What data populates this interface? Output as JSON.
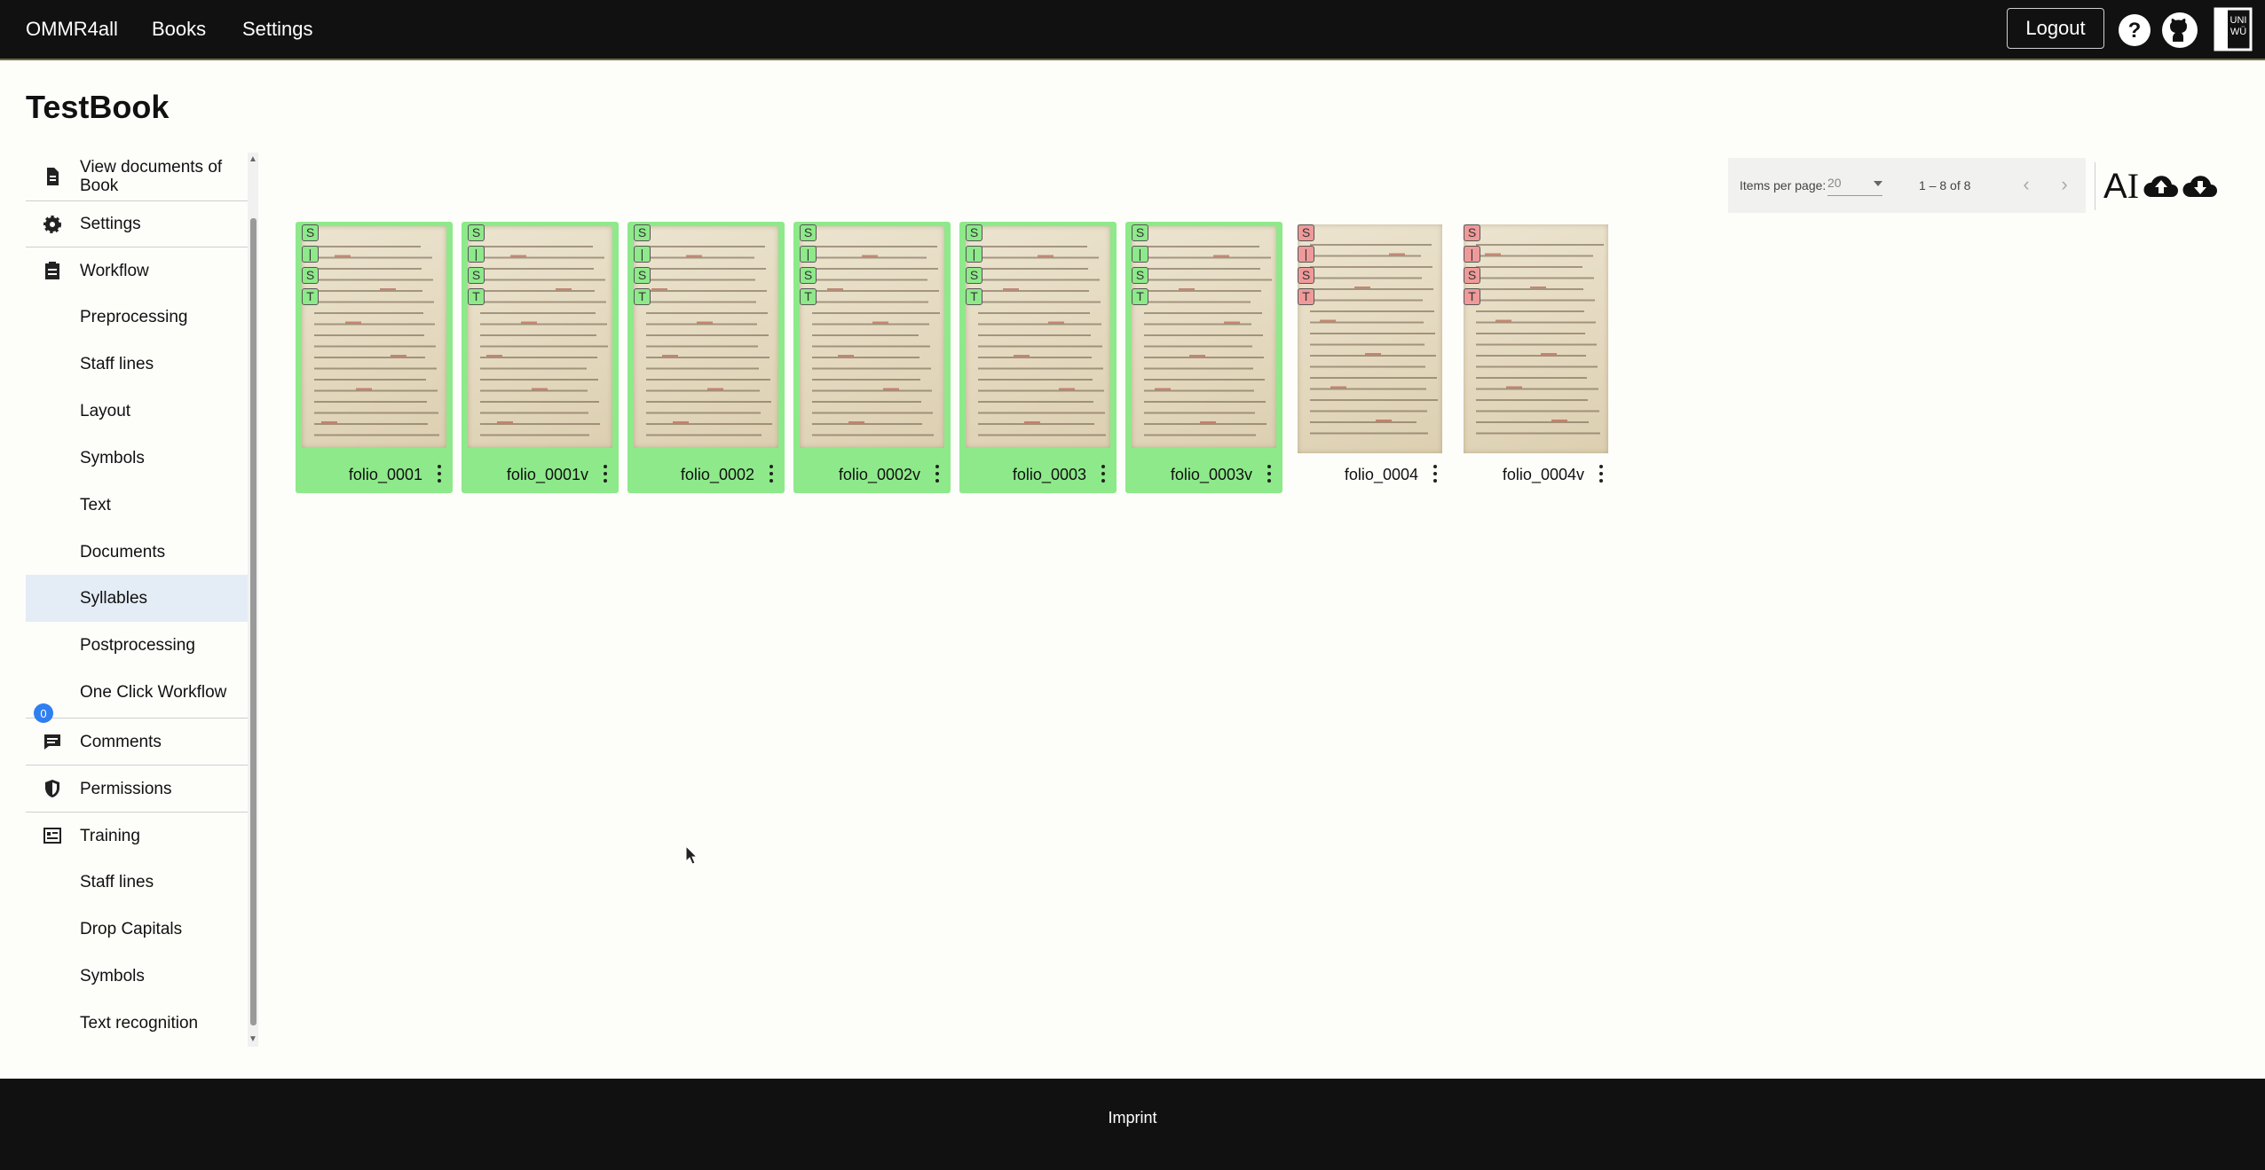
{
  "header": {
    "brand": "OMMR4all",
    "nav": [
      "Books",
      "Settings"
    ],
    "logout_label": "Logout",
    "icons": [
      "help-icon",
      "github-icon",
      "university-logo"
    ],
    "logo_text": "UNI WÜ"
  },
  "page": {
    "title": "TestBook"
  },
  "sidebar": {
    "items": [
      {
        "label": "View documents of Book",
        "icon": "document-icon"
      },
      {
        "label": "Settings",
        "icon": "gear-icon"
      },
      {
        "label": "Workflow",
        "icon": "clipboard-icon"
      },
      {
        "label": "Preprocessing"
      },
      {
        "label": "Staff lines"
      },
      {
        "label": "Layout"
      },
      {
        "label": "Symbols"
      },
      {
        "label": "Text"
      },
      {
        "label": "Documents"
      },
      {
        "label": "Syllables",
        "active": true
      },
      {
        "label": "Postprocessing"
      },
      {
        "label": "One Click Workflow"
      },
      {
        "label": "Comments",
        "icon": "comment-icon",
        "badge": "0"
      },
      {
        "label": "Permissions",
        "icon": "shield-icon"
      },
      {
        "label": "Training",
        "icon": "training-icon"
      },
      {
        "label": "Staff lines"
      },
      {
        "label": "Drop Capitals"
      },
      {
        "label": "Symbols"
      },
      {
        "label": "Text recognition"
      }
    ]
  },
  "paginator": {
    "label": "Items per page:",
    "page_size": "20",
    "range": "1 – 8 of 8",
    "prev_icon": "chevron-left-icon",
    "next_icon": "chevron-right-icon"
  },
  "tools": [
    "ai-text-icon",
    "cloud-upload-icon",
    "cloud-download-icon"
  ],
  "status_letters": [
    "S",
    "|",
    "S",
    "T"
  ],
  "pages": [
    {
      "name": "folio_0001",
      "done": true
    },
    {
      "name": "folio_0001v",
      "done": true
    },
    {
      "name": "folio_0002",
      "done": true
    },
    {
      "name": "folio_0002v",
      "done": true
    },
    {
      "name": "folio_0003",
      "done": true
    },
    {
      "name": "folio_0003v",
      "done": true
    },
    {
      "name": "folio_0004",
      "done": false
    },
    {
      "name": "folio_0004v",
      "done": false
    }
  ],
  "footer": {
    "imprint": "Imprint"
  },
  "colors": {
    "done": "#8ee98a",
    "todo": "#ef9a9a",
    "active_item": "#e4ecf6"
  }
}
